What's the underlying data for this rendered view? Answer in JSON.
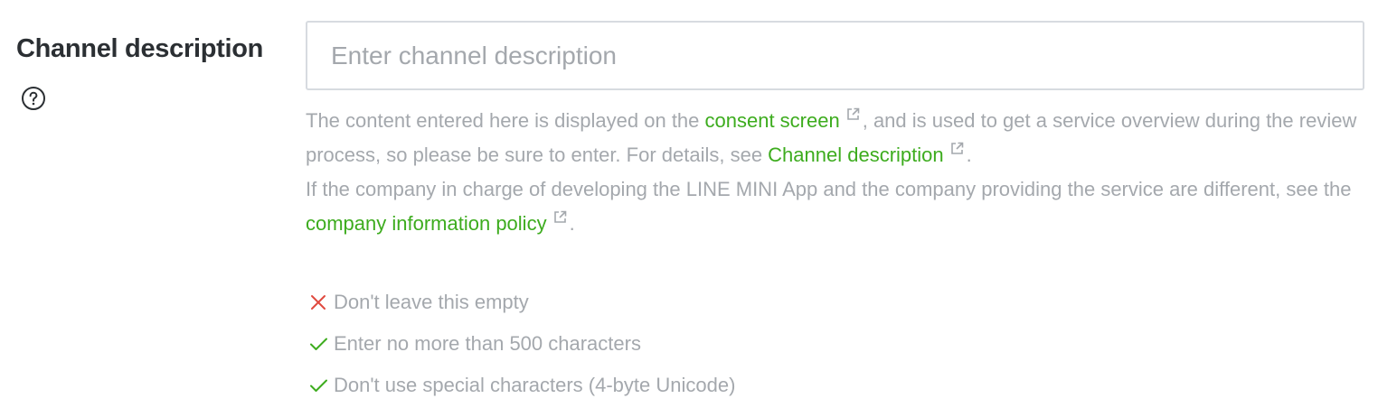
{
  "field": {
    "label": "Channel description",
    "help_icon": "question-circle-icon",
    "placeholder": "Enter channel description",
    "value": ""
  },
  "help": {
    "p1_a": "The content entered here is displayed on the ",
    "p1_link1": "consent screen",
    "p1_b": ", and is used to get a service overview during the review process, so please be sure to enter. For details, see ",
    "p1_link2": "Channel description",
    "p1_c": ".",
    "p2_a": "If the company in charge of developing the LINE MINI App and the company providing the service are different, see the ",
    "p2_link": "company information policy",
    "p2_b": ".",
    "link_icon": "external-link-icon",
    "link_color": "#3dac1e"
  },
  "validation": [
    {
      "status": "error",
      "icon": "x-icon",
      "color": "#e04a3f",
      "text": "Don't leave this empty"
    },
    {
      "status": "ok",
      "icon": "check-icon",
      "color": "#3dac1e",
      "text": "Enter no more than 500 characters"
    },
    {
      "status": "ok",
      "icon": "check-icon",
      "color": "#3dac1e",
      "text": "Don't use special characters (4-byte Unicode)"
    }
  ]
}
